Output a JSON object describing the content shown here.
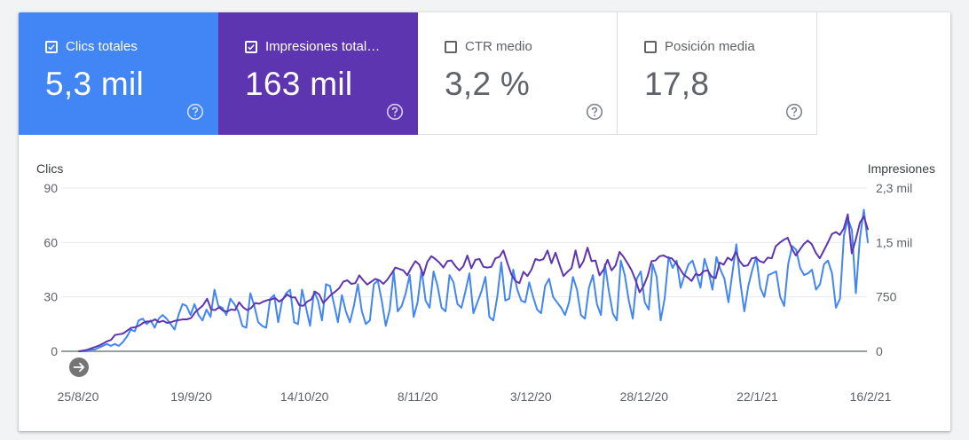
{
  "metrics": [
    {
      "label": "Clics totales",
      "value": "5,3 mil",
      "checked": true,
      "color": "#4285f4"
    },
    {
      "label": "Impresiones total…",
      "value": "163 mil",
      "checked": true,
      "color": "#5e35b1"
    },
    {
      "label": "CTR medio",
      "value": "3,2 %",
      "checked": false,
      "color": "#ffffff"
    },
    {
      "label": "Posición media",
      "value": "17,8",
      "checked": false,
      "color": "#ffffff"
    }
  ],
  "icons": {
    "help": "help-circle-icon",
    "checkbox_checked": "checkbox-checked-icon",
    "checkbox_empty": "checkbox-empty-icon",
    "annotation": "arrow-right-circle-icon"
  },
  "chart_data": {
    "type": "line",
    "y_left_label": "Clics",
    "y_right_label": "Impresiones",
    "y_left_ticks": [
      "90",
      "60",
      "30",
      "0"
    ],
    "y_right_ticks": [
      "2,3 mil",
      "1,5 mil",
      "750",
      "0"
    ],
    "y_left_lim": [
      0,
      90
    ],
    "y_right_lim": [
      0,
      2300
    ],
    "grid": true,
    "x_labels": [
      "25/8/20",
      "19/9/20",
      "14/10/20",
      "8/11/20",
      "3/12/20",
      "28/12/20",
      "22/1/21",
      "16/2/21"
    ],
    "x_range": [
      "2020-08-25",
      "2021-02-19"
    ],
    "series": [
      {
        "name": "Clics",
        "axis": "left",
        "color": "#4285f4",
        "values": [
          0,
          0,
          0,
          1,
          1,
          2,
          3,
          4,
          3,
          4,
          3,
          5,
          8,
          12,
          11,
          17,
          18,
          15,
          17,
          13,
          18,
          20,
          18,
          15,
          12,
          20,
          26,
          25,
          20,
          26,
          20,
          17,
          23,
          19,
          34,
          25,
          24,
          20,
          29,
          26,
          22,
          14,
          13,
          32,
          25,
          16,
          14,
          13,
          29,
          31,
          16,
          28,
          32,
          34,
          16,
          15,
          34,
          24,
          14,
          33,
          28,
          17,
          37,
          36,
          26,
          16,
          31,
          22,
          16,
          25,
          37,
          22,
          15,
          17,
          37,
          39,
          28,
          14,
          23,
          44,
          22,
          25,
          32,
          42,
          19,
          27,
          45,
          28,
          24,
          44,
          36,
          24,
          22,
          42,
          38,
          26,
          24,
          33,
          43,
          21,
          27,
          33,
          41,
          19,
          17,
          30,
          49,
          28,
          29,
          45,
          34,
          28,
          27,
          38,
          30,
          23,
          21,
          36,
          40,
          30,
          27,
          24,
          20,
          27,
          41,
          34,
          20,
          18,
          35,
          42,
          26,
          20,
          48,
          33,
          21,
          17,
          50,
          42,
          28,
          18,
          40,
          44,
          27,
          23,
          48,
          41,
          17,
          29,
          52,
          46,
          50,
          35,
          42,
          48,
          50,
          43,
          35,
          51,
          44,
          34,
          52,
          45,
          40,
          27,
          43,
          59,
          38,
          22,
          36,
          45,
          52,
          35,
          30,
          42,
          43,
          44,
          30,
          25,
          48,
          58,
          56,
          46,
          42,
          43,
          45,
          34,
          37,
          48,
          50,
          43,
          24,
          29,
          64,
          73,
          67,
          32,
          62,
          78,
          60
        ]
      },
      {
        "name": "Impresiones",
        "axis": "right",
        "color": "#5e35b1",
        "values": [
          0,
          10,
          20,
          40,
          60,
          80,
          110,
          140,
          160,
          230,
          240,
          250,
          290,
          330,
          340,
          360,
          400,
          420,
          420,
          450,
          410,
          430,
          400,
          410,
          430,
          440,
          450,
          450,
          470,
          550,
          600,
          650,
          740,
          590,
          580,
          620,
          570,
          560,
          590,
          580,
          690,
          620,
          580,
          610,
          680,
          670,
          700,
          720,
          730,
          750,
          700,
          740,
          800,
          760,
          760,
          650,
          640,
          700,
          730,
          840,
          800,
          680,
          740,
          800,
          840,
          890,
          980,
          1000,
          950,
          960,
          1070,
          1000,
          940,
          980,
          1020,
          1000,
          950,
          1010,
          1090,
          1180,
          1160,
          1140,
          1070,
          1180,
          1270,
          1220,
          1070,
          1260,
          1340,
          1300,
          1250,
          1180,
          1270,
          1280,
          1200,
          1140,
          1200,
          1350,
          1170,
          1290,
          1300,
          1190,
          1180,
          1190,
          1310,
          1330,
          1420,
          1240,
          1080,
          990,
          960,
          1120,
          1060,
          1150,
          1300,
          1280,
          1300,
          1420,
          1240,
          1390,
          1220,
          1060,
          1120,
          1170,
          1420,
          1180,
          1270,
          1460,
          1270,
          1280,
          1070,
          1150,
          1290,
          1140,
          1210,
          1400,
          1330,
          1240,
          1140,
          1000,
          830,
          920,
          1060,
          1270,
          1280,
          1340,
          1350,
          1320,
          1310,
          1250,
          1170,
          1080,
          1040,
          990,
          1090,
          1070,
          1130,
          1140,
          1050,
          1030,
          1250,
          1220,
          1320,
          1280,
          1400,
          1270,
          1200,
          1210,
          1310,
          1320,
          1270,
          1250,
          1320,
          1310,
          1480,
          1530,
          1570,
          1600,
          1450,
          1350,
          1430,
          1510,
          1560,
          1510,
          1390,
          1310,
          1420,
          1530,
          1650,
          1680,
          1640,
          1730,
          1930,
          1380,
          1580,
          1810,
          1900,
          1720
        ]
      }
    ]
  }
}
